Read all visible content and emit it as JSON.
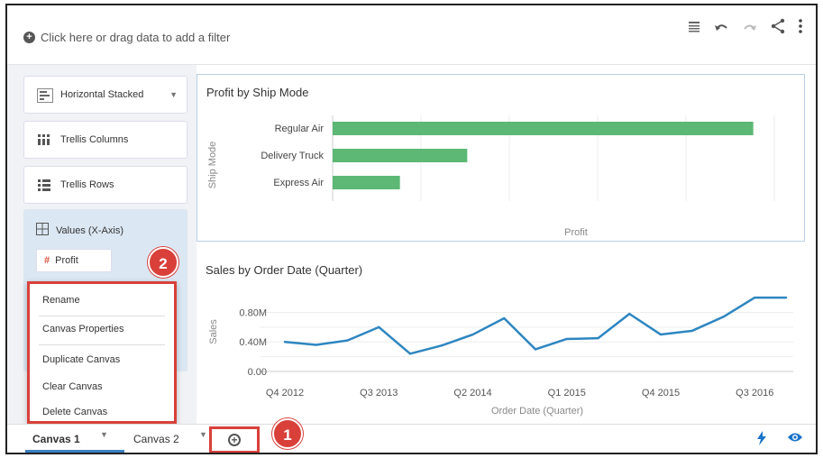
{
  "filterbar": {
    "add_filter_text": "Click here or drag data to add a filter"
  },
  "toolbar": {
    "icons": [
      "menu-lines-icon",
      "undo-icon",
      "redo-icon",
      "share-icon",
      "more-vert-icon"
    ]
  },
  "left_panel": {
    "chart_type_label": "Horizontal Stacked",
    "trellis_columns_label": "Trellis Columns",
    "trellis_rows_label": "Trellis Rows",
    "values_label": "Values (X-Axis)",
    "profit_pill_label": "Profit"
  },
  "context_menu": {
    "items": [
      "Rename",
      "Canvas Properties",
      "Duplicate Canvas",
      "Clear Canvas",
      "Delete Canvas"
    ]
  },
  "callouts": {
    "badge_one": "1",
    "badge_two": "2"
  },
  "chart1": {
    "title": "Profit by Ship Mode",
    "ylabel": "Ship Mode",
    "xlabel": "Profit"
  },
  "chart2": {
    "title": "Sales by Order Date (Quarter)",
    "ylabel": "Sales",
    "xlabel": "Order Date (Quarter)"
  },
  "tabs": {
    "canvas1": "Canvas 1",
    "canvas2": "Canvas 2"
  },
  "colors": {
    "bar_green": "#5cb874",
    "line_blue": "#2e86c1",
    "callout_red": "#d9403a",
    "accent_blue": "#1a73c9"
  },
  "chart_data": [
    {
      "type": "bar",
      "title": "Profit by Ship Mode",
      "xlabel": "Profit",
      "ylabel": "Ship Mode",
      "orientation": "horizontal",
      "categories": [
        "Regular Air",
        "Delivery Truck",
        "Express Air"
      ],
      "values": [
        100,
        32,
        16
      ],
      "xlim": [
        0,
        105
      ]
    },
    {
      "type": "line",
      "title": "Sales by Order Date (Quarter)",
      "xlabel": "Order Date (Quarter)",
      "ylabel": "Sales",
      "x": [
        "Q4 2012",
        "Q1 2013",
        "Q2 2013",
        "Q3 2013",
        "Q4 2013",
        "Q1 2014",
        "Q2 2014",
        "Q3 2014",
        "Q4 2014",
        "Q1 2015",
        "Q2 2015",
        "Q3 2015",
        "Q4 2015",
        "Q1 2016",
        "Q2 2016",
        "Q3 2016",
        "Q4 2016"
      ],
      "values": [
        0.4,
        0.36,
        0.42,
        0.6,
        0.24,
        0.35,
        0.5,
        0.72,
        0.3,
        0.44,
        0.45,
        0.78,
        0.5,
        0.55,
        0.74,
        1.0,
        1.0
      ],
      "x_tick_labels": [
        "Q4 2012",
        "Q3 2013",
        "Q2 2014",
        "Q1 2015",
        "Q4 2015",
        "Q3 2016"
      ],
      "y_tick_labels": [
        "0.00",
        "0.40M",
        "0.80M"
      ],
      "ylim": [
        0,
        1.05
      ]
    }
  ]
}
